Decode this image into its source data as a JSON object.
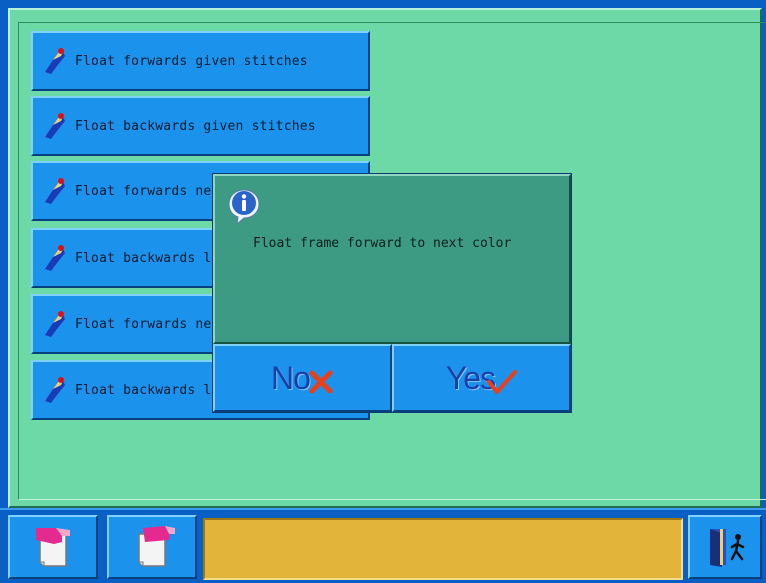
{
  "menu": {
    "items": [
      {
        "label": "Float forwards given stitches",
        "icon": "hand-pointer-icon"
      },
      {
        "label": "Float backwards given stitches",
        "icon": "hand-pointer-icon"
      },
      {
        "label": "Float forwards ne",
        "icon": "hand-pointer-icon"
      },
      {
        "label": "Float backwards l",
        "icon": "hand-pointer-icon"
      },
      {
        "label": "Float forwards ne",
        "icon": "hand-pointer-icon"
      },
      {
        "label": "Float backwards l",
        "icon": "hand-pointer-icon"
      }
    ]
  },
  "dialog": {
    "message": "Float frame forward to next color",
    "icon": "info-icon",
    "no_label": "No",
    "yes_label": "Yes"
  },
  "footer": {
    "status_text": "",
    "left_icon_1": "hand-page-back-icon",
    "left_icon_2": "hand-page-forward-icon",
    "exit_icon": "exit-door-icon"
  },
  "colors": {
    "panel": "#6cd9a6",
    "button": "#1b93ec",
    "dialog": "#3d9b84",
    "status": "#e2b53a",
    "frame": "#0a5fc4"
  }
}
